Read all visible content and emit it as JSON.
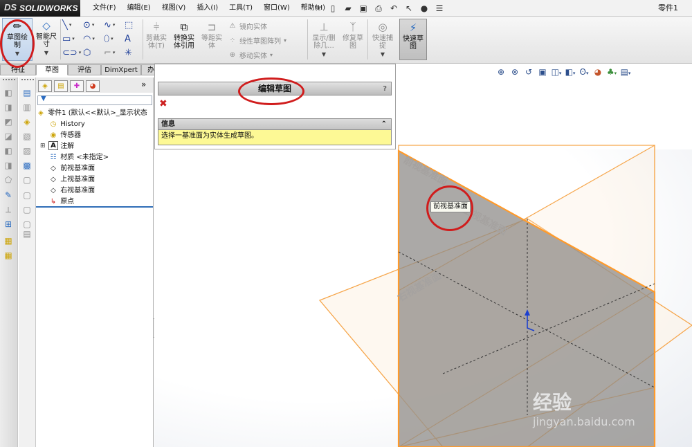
{
  "app": {
    "name": "SOLIDWORKS",
    "logo_mark": "DS",
    "document_title": "零件1"
  },
  "menu": [
    "文件(F)",
    "编辑(E)",
    "视图(V)",
    "插入(I)",
    "工具(T)",
    "窗口(W)",
    "帮助(H)"
  ],
  "quick_access": [
    "pin-icon",
    "new-file-icon",
    "open-icon",
    "save-icon",
    "print-icon",
    "undo-icon",
    "select-icon",
    "rebuild-icon",
    "options-icon"
  ],
  "command_manager": {
    "sketch": "草图绘制",
    "smart_dimension": "智能尺寸",
    "trim": "剪裁实体(T)",
    "convert": "转换实体引用",
    "offset": "等距实体",
    "mirror": "镜向实体",
    "linear_pattern": "线性草图阵列",
    "move": "移动实体",
    "display_delete": "显示/删除几...",
    "repair": "修复草图",
    "quick_snap": "快速捕捉",
    "rapid_sketch": "快速草图"
  },
  "tabs": [
    "特征",
    "草图",
    "评估",
    "DimXpert",
    "办公室产品"
  ],
  "tree": {
    "root": "零件1  (默认<<默认>_显示状态",
    "items": [
      "History",
      "传感器",
      "注解",
      "材质 <未指定>",
      "前视基准面",
      "上视基准面",
      "右视基准面",
      "原点"
    ]
  },
  "property_manager": {
    "title": "编辑草图",
    "help": "?",
    "info_label": "信息",
    "info_text": "选择一基准面为实体生成草图。"
  },
  "viewport": {
    "tooltip": "前视基准面",
    "plane_front": "前视基准面",
    "plane_top": "上视基准面",
    "plane_right": "右视基准面",
    "plane_color": "#f6a64b",
    "selected_plane_fill": "#8f8c8a"
  },
  "watermark": {
    "line1": "经验",
    "line2": "jingyan.baidu.com"
  }
}
